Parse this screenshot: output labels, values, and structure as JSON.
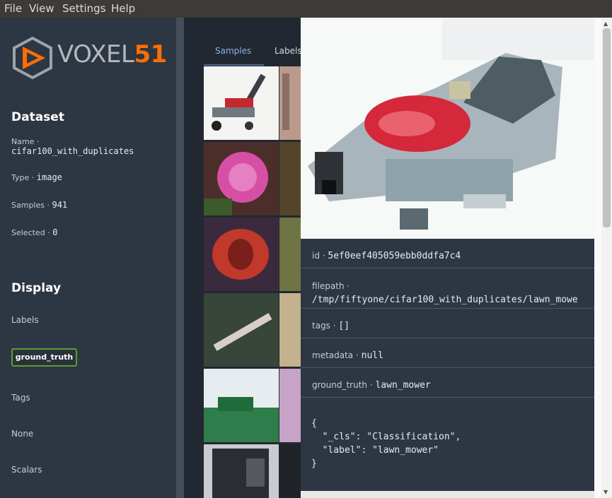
{
  "menu": [
    "File",
    "View",
    "Settings",
    "Help"
  ],
  "brand": {
    "word": "VOXEL",
    "number": "51",
    "accent": "#ff6d04"
  },
  "dataset": {
    "title": "Dataset",
    "name_label": "Name",
    "name_value": "cifar100_with_duplicates",
    "type_label": "Type",
    "type_value": "image",
    "samples_label": "Samples",
    "samples_value": "941",
    "selected_label": "Selected",
    "selected_value": "0"
  },
  "display": {
    "title": "Display",
    "labels_heading": "Labels",
    "label_chip": "ground_truth",
    "tags_heading": "Tags",
    "tags_value": "None",
    "scalars_heading": "Scalars"
  },
  "tabs": [
    "Samples",
    "Labels"
  ],
  "sample": {
    "id_label": "id",
    "id_value": "5ef0eef405059ebb0ddfa7c4",
    "filepath_label": "filepath",
    "filepath_value": "/tmp/fiftyone/cifar100_with_duplicates/lawn_mowe",
    "tags_label": "tags",
    "tags_value": "[]",
    "metadata_label": "metadata",
    "metadata_value": "null",
    "gt_label": "ground_truth",
    "gt_value": "lawn_mower",
    "json_lines": [
      "{",
      "  \"_cls\": \"Classification\",",
      "  \"label\": \"lawn_mower\"",
      "}"
    ]
  }
}
